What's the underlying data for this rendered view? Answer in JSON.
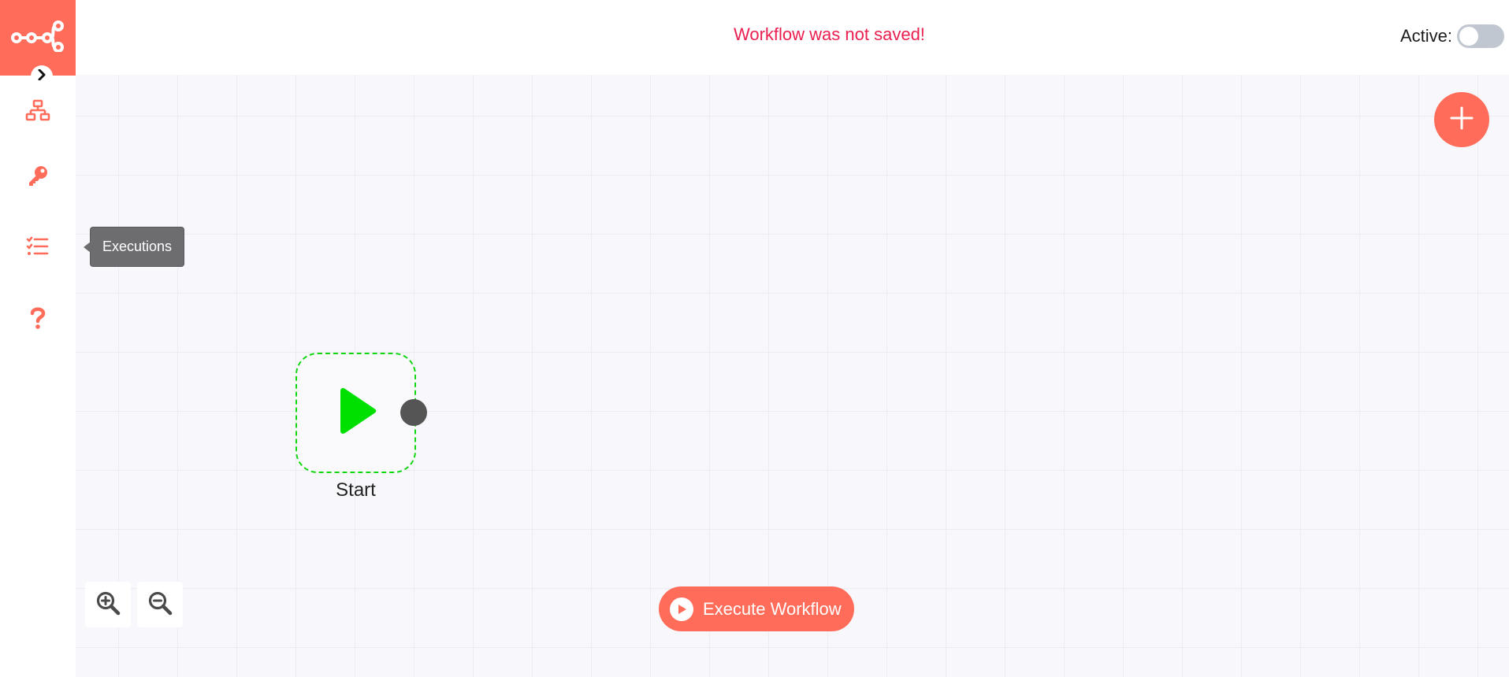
{
  "header": {
    "save_status": "Workflow was not saved!",
    "active_label": "Active:",
    "active": false
  },
  "sidebar": {
    "logo_icon": "n8n-logo-icon",
    "collapse_icon": "chevron-right-icon",
    "items": [
      {
        "name": "workflows",
        "icon": "network-icon"
      },
      {
        "name": "credentials",
        "icon": "key-icon"
      },
      {
        "name": "executions",
        "icon": "tasks-icon"
      },
      {
        "name": "help",
        "icon": "question-icon"
      }
    ],
    "tooltip": "Executions"
  },
  "canvas": {
    "add_node_icon": "plus-icon",
    "nodes": [
      {
        "label": "Start",
        "icon": "play-icon",
        "color": "#00e000"
      }
    ],
    "zoom_in_icon": "zoom-in-icon",
    "zoom_out_icon": "zoom-out-icon",
    "execute_button": {
      "label": "Execute Workflow",
      "icon": "play-circle-icon"
    }
  },
  "colors": {
    "brand": "#ff6d5a",
    "warning_text": "#ea1f4f",
    "node_border": "#13d613",
    "toggle_off": "#c0c7d1"
  }
}
